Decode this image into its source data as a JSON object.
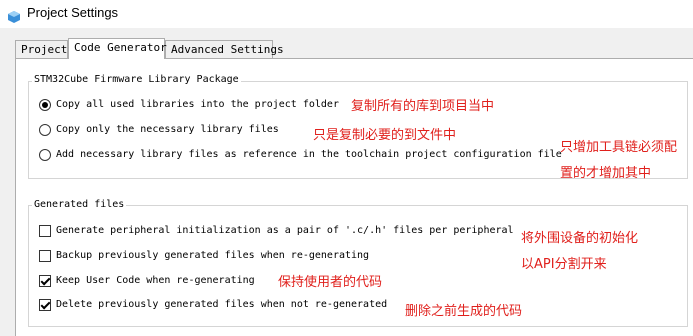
{
  "window": {
    "title": "Project Settings",
    "icon": "cube-icon"
  },
  "tabs": [
    {
      "label": "Project",
      "active": false
    },
    {
      "label": "Code Generator",
      "active": true
    },
    {
      "label": "Advanced Settings",
      "active": false
    }
  ],
  "firmware_group": {
    "title": "STM32Cube Firmware Library Package",
    "options": [
      {
        "label": "Copy all used libraries into the project folder",
        "selected": true
      },
      {
        "label": "Copy only the necessary library files",
        "selected": false
      },
      {
        "label": "Add necessary library files as reference in the toolchain project configuration file",
        "selected": false
      }
    ]
  },
  "generated_group": {
    "title": "Generated files",
    "options": [
      {
        "label": "Generate peripheral initialization as a pair of '.c/.h' files per peripheral",
        "checked": false
      },
      {
        "label": "Backup previously generated files when re-generating",
        "checked": false
      },
      {
        "label": "Keep User Code when re-generating",
        "checked": true
      },
      {
        "label": "Delete previously generated files when not re-generated",
        "checked": true
      }
    ]
  },
  "annotations": {
    "copy_all": "复制所有的库到项目当中",
    "copy_necessary": "只是复制必要的到文件中",
    "reference_line1": "只增加工具链必须配",
    "reference_line2": "置的才增加其中",
    "per_peripheral_line1": "将外围设备的初始化",
    "per_peripheral_line2": "以API分割开来",
    "keep_user_code": "保持使用者的代码",
    "delete_previous": "删除之前生成的代码"
  },
  "colors": {
    "annotation": "#e0201c",
    "panel": "#ffffff",
    "chrome": "#f0f0f0"
  }
}
